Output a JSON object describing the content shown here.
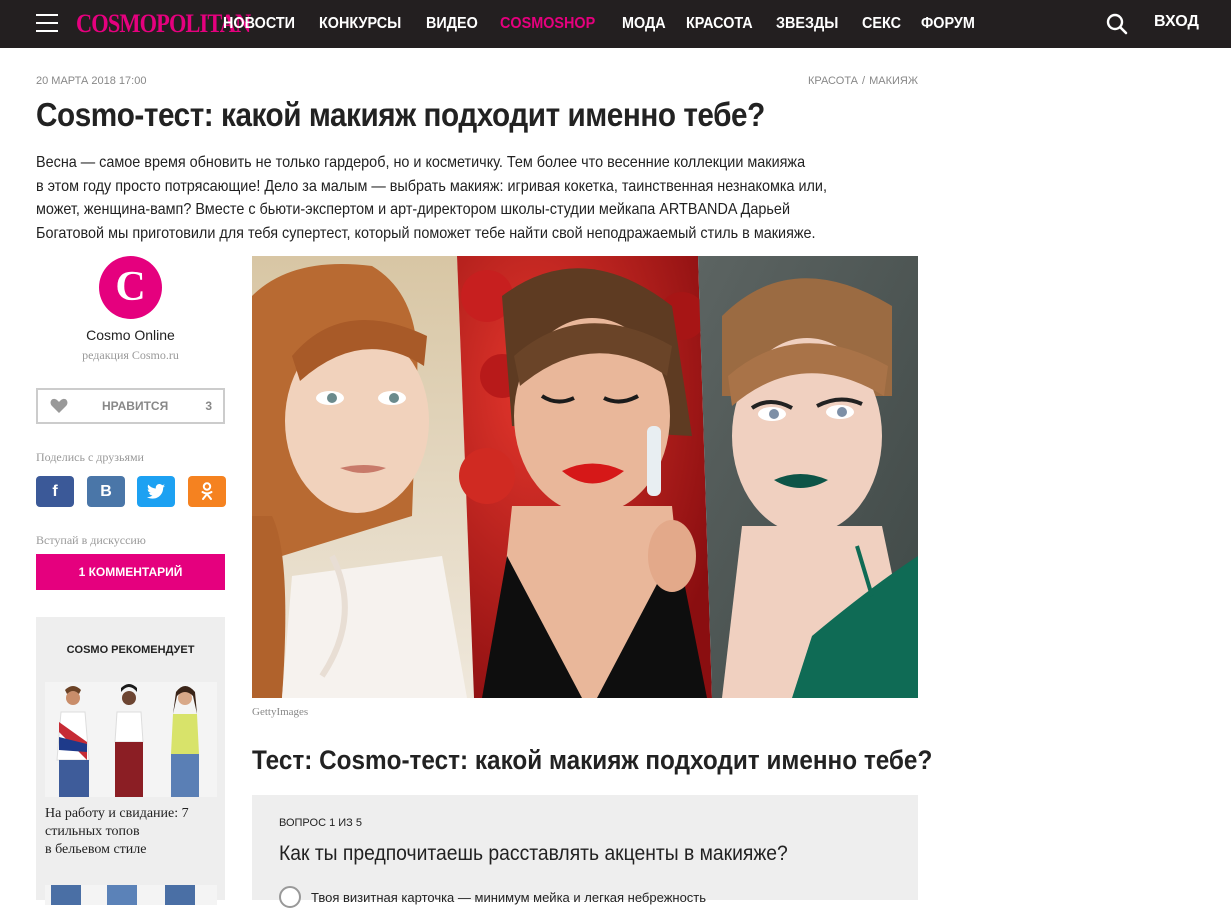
{
  "header": {
    "logo": "COSMOPOLITAN",
    "nav": [
      "НОВОСТИ",
      "КОНКУРСЫ",
      "ВИДЕО",
      "COSMOSHOP",
      "МОДА",
      "КРАСОТА",
      "ЗВЕЗДЫ",
      "СЕКС",
      "ФОРУМ"
    ],
    "login": "ВХОД"
  },
  "article": {
    "date": "20 МАРТА 2018 17:00",
    "breadcrumb": [
      "КРАСОТА",
      "/",
      "МАКИЯЖ"
    ],
    "title": "Cosmo-тест: какой макияж подходит именно тебе?",
    "lead_lines": [
      "Весна — самое время обновить не только гардероб, но и косметичку. Тем более что весенние коллекции макияжа",
      "в этом году просто потрясающие! Дело за малым — выбрать макияж: игривая кокетка, таинственная незнакомка или,",
      "может, женщина-вамп? Вместе с бьюти-экспертом и арт-директором школы-студии мейкапа ARTBANDA Дарьей",
      "Богатовой мы приготовили для тебя супертест, который поможет тебе найти свой неподражаемый стиль в макияже."
    ],
    "image_credit": "GettyImages"
  },
  "author": {
    "avatar_letter": "C",
    "name": "Cosmo Online",
    "role": "редакция Cosmo.ru"
  },
  "like": {
    "label": "НРАВИТСЯ",
    "count": "3"
  },
  "share": {
    "label": "Поделись с друзьями",
    "buttons": [
      "f",
      "B",
      "twitter",
      "ok"
    ]
  },
  "discussion": {
    "label": "Вступай в дискуссию",
    "comments_button": "1 КОММЕНТАРИЙ"
  },
  "recommend": {
    "title": "COSMO РЕКОМЕНДУЕТ",
    "item_text": [
      "На работу и свидание: 7",
      "стильных топов",
      "в бельевом стиле"
    ]
  },
  "test": {
    "title": "Тест: Cosmo-тест: какой макияж подходит именно тебе?",
    "question_number": "ВОПРОС 1 ИЗ 5",
    "question": "Как ты предпочитаешь расставлять акценты в макияже?",
    "option_1": "Твоя визитная карточка — минимум мейка и легкая небрежность"
  },
  "colors": {
    "brand": "#e5007e",
    "topbar": "#231f20",
    "facebook": "#3b5998",
    "vk": "#4a76a8",
    "twitter": "#1da1f2",
    "ok": "#f58220"
  }
}
